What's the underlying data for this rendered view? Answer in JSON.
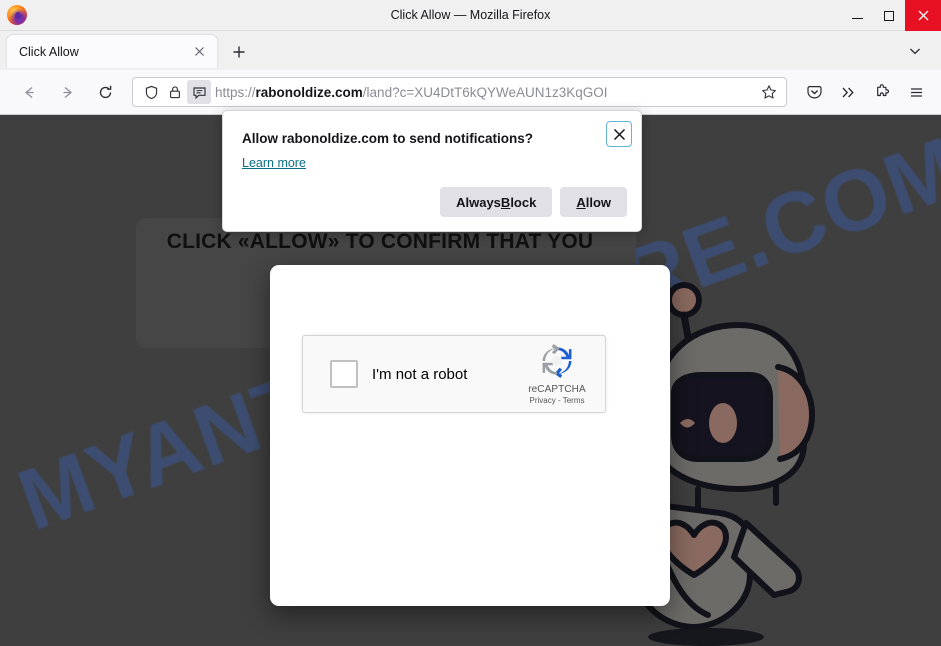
{
  "window": {
    "title": "Click Allow — Mozilla Firefox",
    "app_icon": "firefox-logo",
    "minimize_label": "Minimize",
    "maximize_label": "Maximize",
    "close_label": "Close"
  },
  "tabs": {
    "items": [
      {
        "title": "Click Allow",
        "close_label": "Close tab"
      }
    ],
    "new_tab_label": "New tab",
    "list_all_tabs_label": "List all tabs"
  },
  "navigation": {
    "back_label": "Back",
    "forward_label": "Forward",
    "reload_label": "Reload",
    "urlbar": {
      "scheme": "https://",
      "host": "rabonoldize.com",
      "path": "/land?c=XU4DtT6kQYWeAUN1z3KqGOI",
      "shield_label": "Enhanced Tracking Protection",
      "lock_label": "Connection secure",
      "permission_label": "Notification permission requested",
      "bookmark_label": "Bookmark this page"
    },
    "toolbar_right": [
      {
        "name": "pocket-icon",
        "label": "Save to Pocket"
      },
      {
        "name": "overflow-icon",
        "label": "More tools"
      },
      {
        "name": "extensions-icon",
        "label": "Extensions"
      },
      {
        "name": "app-menu-icon",
        "label": "Open application menu"
      }
    ]
  },
  "notification_popup": {
    "title": "Allow rabonoldize.com to send notifications?",
    "learn_more": "Learn more",
    "close_label": "Close",
    "buttons": {
      "always_block_prefix": "Always ",
      "always_block_accel": "B",
      "always_block_suffix": "lock",
      "allow_accel": "A",
      "allow_suffix": "llow"
    }
  },
  "page": {
    "watermark": "MYANTISPYWARE.COM",
    "headline": "CLICK «ALLOW» TO CONFIRM THAT YOU",
    "background_color": "#3f3f3f",
    "card_color": "#464646",
    "illustration": "robot-illustration"
  },
  "captcha": {
    "checkbox_label": "I'm not a robot",
    "brand": "reCAPTCHA",
    "privacy": "Privacy",
    "separator": " - ",
    "terms": "Terms",
    "logo_name": "recaptcha-logo"
  },
  "colors": {
    "accent_blue": "#3c5a9a",
    "close_red": "#e81123",
    "link_teal": "#0a6e85",
    "focus_ring": "#61b5d6"
  }
}
